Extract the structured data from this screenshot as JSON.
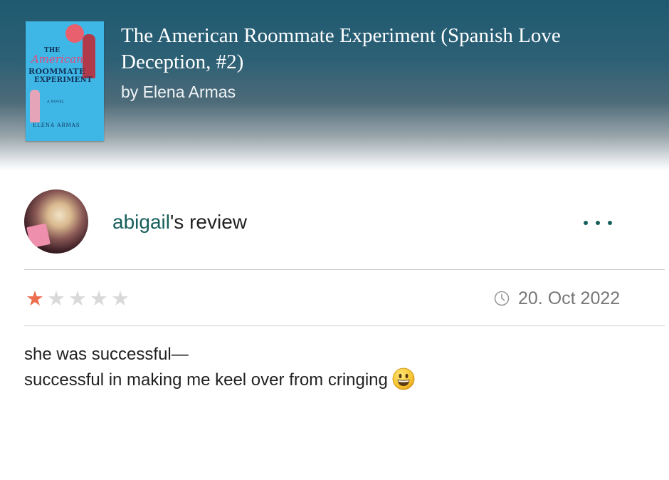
{
  "book": {
    "title": "The American Roommate Experiment (Spanish Love Deception, #2)",
    "author_line": "by Elena Armas",
    "cover": {
      "line1": "THE",
      "line2": "American",
      "line3": "ROOMMATE",
      "line4": "EXPERIMENT",
      "line5": "A NOVEL",
      "author": "ELENA ARMAS",
      "background_color": "#3fb7e6"
    }
  },
  "review": {
    "reviewer_name": "abigail",
    "reviewer_suffix": "'s review",
    "more_icon": "ellipsis-icon",
    "rating": 1,
    "rating_max": 5,
    "date": "20. Oct 2022",
    "date_icon": "clock-icon",
    "lines": [
      "she was successful—",
      "successful in making me keel over from cringing"
    ],
    "emoji_icon": "grinning-face-icon"
  },
  "colors": {
    "header_top": "#1f5a71",
    "accent_green": "#175f5b",
    "star_filled": "#ed6d4f",
    "star_empty": "#d9d9d9",
    "meta_gray": "#777777",
    "divider": "#cfcfcf"
  }
}
